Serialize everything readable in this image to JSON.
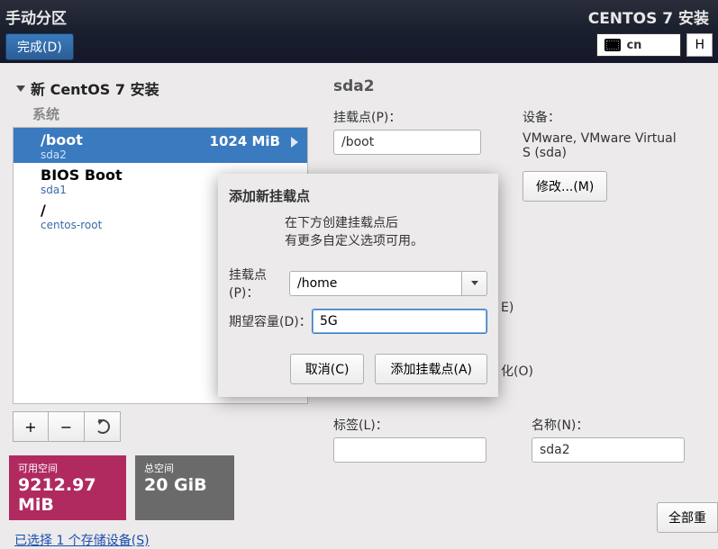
{
  "topbar": {
    "title": "手动分区",
    "done": "完成(D)",
    "install_title": "CENTOS 7 安装",
    "kbd": "cn",
    "help": "H"
  },
  "tree": {
    "root": "新 CentOS 7 安装",
    "section": "系统",
    "items": [
      {
        "mount": "/boot",
        "size": "1024 MiB",
        "dev": "sda2",
        "selected": true
      },
      {
        "mount": "BIOS Boot",
        "size": "",
        "dev": "sda1",
        "selected": false
      },
      {
        "mount": "/",
        "size": "",
        "dev": "centos-root",
        "selected": false
      }
    ]
  },
  "tb": {
    "add": "+",
    "remove": "−",
    "reload": ""
  },
  "right": {
    "device_header": "sda2",
    "mount_label": "挂载点(P)：",
    "mount_value": "/boot",
    "device_label": "设备：",
    "device_value": "VMware, VMware Virtual S (sda)",
    "modify": "修改...(M)",
    "encrypt_suffix": "E)",
    "format_suffix": "化(O)",
    "label_label": "标签(L)：",
    "label_value": "",
    "name_label": "名称(N)：",
    "name_value": "sda2"
  },
  "status": {
    "avail_label": "可用空间",
    "avail_value": "9212.97 MiB",
    "total_label": "总空间",
    "total_value": "20 GiB",
    "link": "已选择 1 个存储设备(S)",
    "reset": "全部重"
  },
  "modal": {
    "title": "添加新挂载点",
    "desc1": "在下方创建挂载点后",
    "desc2": "有更多自定义选项可用。",
    "mount_label": "挂载点(P)：",
    "mount_value": "/home",
    "cap_label": "期望容量(D)：",
    "cap_value": "5G",
    "cancel": "取消(C)",
    "add": "添加挂载点(A)"
  }
}
